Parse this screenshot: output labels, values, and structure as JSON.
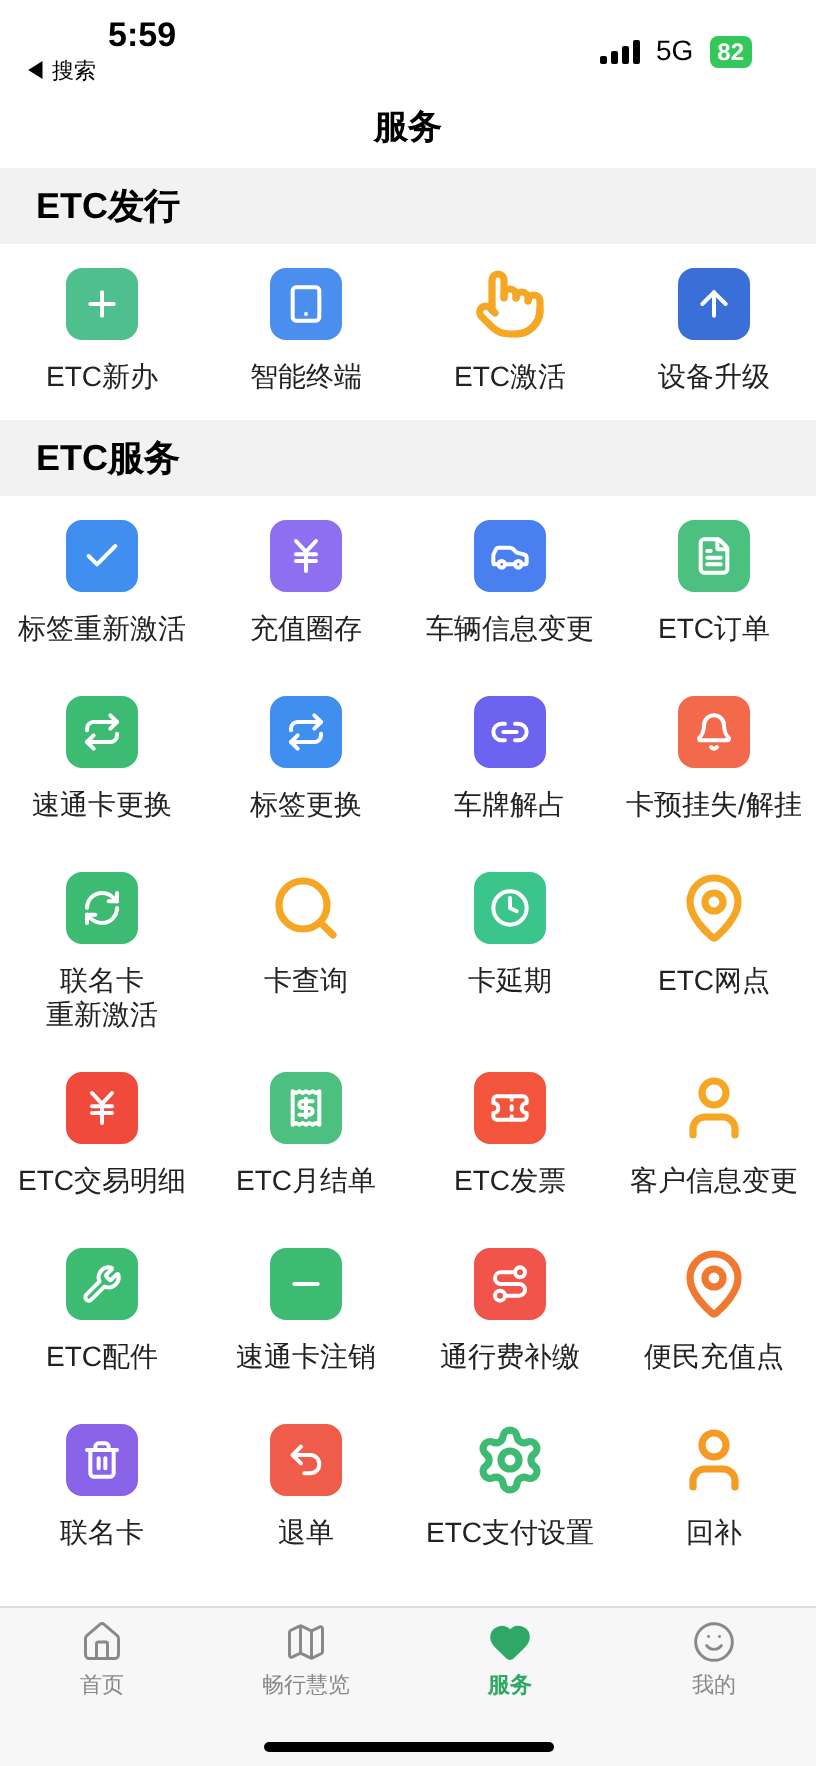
{
  "status_bar": {
    "time": "5:59",
    "back_app": "◀ 搜索",
    "network": "5G",
    "battery": "82"
  },
  "title": "服务",
  "sections": [
    {
      "title": "ETC发行",
      "items": [
        {
          "label": "ETC新办",
          "kind": "card-plus"
        },
        {
          "label": "智能终端",
          "kind": "terminal"
        },
        {
          "label": "ETC激活",
          "kind": "tap"
        },
        {
          "label": "设备升级",
          "kind": "upgrade"
        }
      ]
    },
    {
      "title": "ETC服务",
      "items": [
        {
          "label": "标签重新激活",
          "kind": "tag-check"
        },
        {
          "label": "充值圈存",
          "kind": "yuan-circle"
        },
        {
          "label": "车辆信息变更",
          "kind": "car-doc"
        },
        {
          "label": "ETC订单",
          "kind": "order"
        },
        {
          "label": "速通卡更换",
          "kind": "card-swap"
        },
        {
          "label": "标签更换",
          "kind": "tag-swap"
        },
        {
          "label": "车牌解占",
          "kind": "plate"
        },
        {
          "label": "卡预挂失/解挂",
          "kind": "bell"
        },
        {
          "label": [
            "联名卡",
            "重新激活"
          ],
          "kind": "card-refresh"
        },
        {
          "label": "卡查询",
          "kind": "search"
        },
        {
          "label": "卡延期",
          "kind": "clock"
        },
        {
          "label": "ETC网点",
          "kind": "pin"
        },
        {
          "label": "ETC交易明细",
          "kind": "yuan-square"
        },
        {
          "label": "ETC月结单",
          "kind": "receipt"
        },
        {
          "label": "ETC发票",
          "kind": "ticket"
        },
        {
          "label": "客户信息变更",
          "kind": "person-edit"
        },
        {
          "label": "ETC配件",
          "kind": "toolbox"
        },
        {
          "label": "速通卡注销",
          "kind": "card-minus"
        },
        {
          "label": "通行费补缴",
          "kind": "road"
        },
        {
          "label": "便民充值点",
          "kind": "pin-yuan"
        },
        {
          "label": "联名卡",
          "kind": "trash"
        },
        {
          "label": "退单",
          "kind": "return-box"
        },
        {
          "label": "ETC支付设置",
          "kind": "gear-wrench"
        },
        {
          "label": "回补",
          "kind": "person-yuan"
        }
      ]
    }
  ],
  "tabs": [
    {
      "label": "首页",
      "kind": "home",
      "selected": false
    },
    {
      "label": "畅行慧览",
      "kind": "map",
      "selected": false
    },
    {
      "label": "服务",
      "kind": "heart",
      "selected": true
    },
    {
      "label": "我的",
      "kind": "face",
      "selected": false
    }
  ]
}
